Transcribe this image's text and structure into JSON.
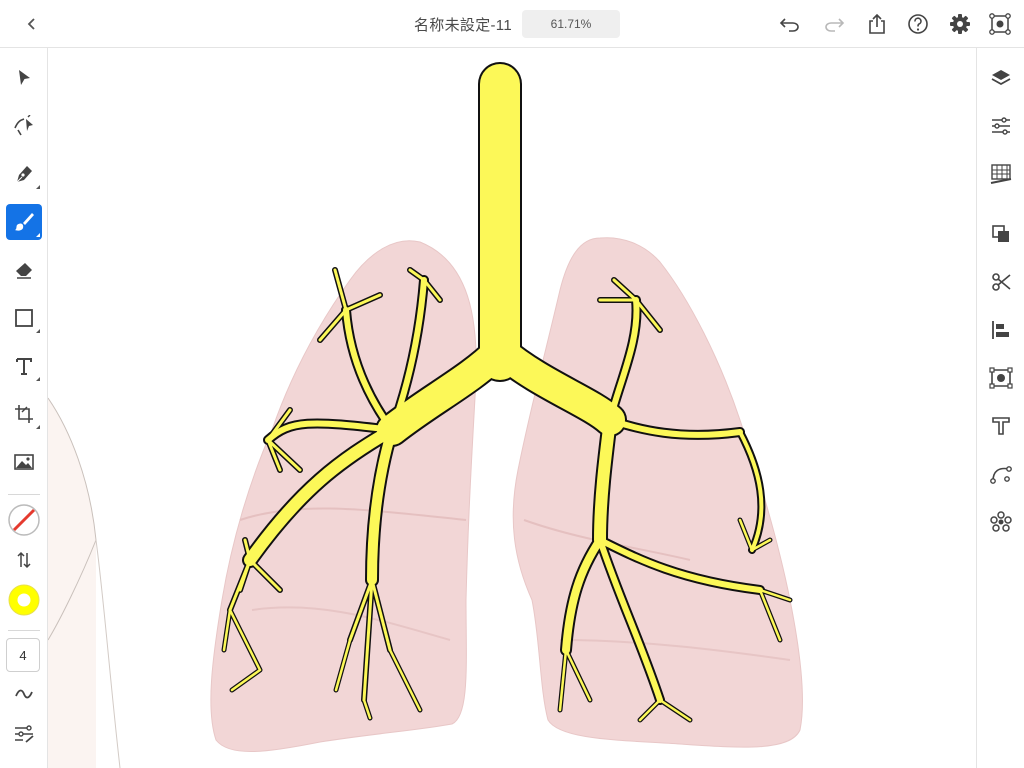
{
  "header": {
    "back_icon": "chevron-left-icon",
    "document_title": "名称未設定-11",
    "zoom_level": "61.71%",
    "actions": [
      {
        "name": "undo-icon"
      },
      {
        "name": "redo-icon"
      },
      {
        "name": "share-icon"
      },
      {
        "name": "help-icon"
      },
      {
        "name": "settings-icon"
      },
      {
        "name": "touch-shortcut-icon"
      }
    ]
  },
  "left_toolbar": {
    "tools": [
      {
        "name": "selection-tool-icon"
      },
      {
        "name": "shaper-tool-icon"
      },
      {
        "name": "pen-tool-icon"
      },
      {
        "name": "brush-tool-icon",
        "active": true
      },
      {
        "name": "eraser-tool-icon"
      },
      {
        "name": "shape-tool-icon"
      },
      {
        "name": "type-tool-icon"
      },
      {
        "name": "transform-tool-icon"
      },
      {
        "name": "image-place-icon"
      }
    ],
    "stroke_color_state": "none",
    "fill_color": "#ffff00",
    "stroke_size": "4",
    "smoothing_icon": "tilde-icon",
    "brush_settings_icon": "brush-settings-icon"
  },
  "right_toolbar": {
    "tools": [
      {
        "name": "layers-icon"
      },
      {
        "name": "properties-icon"
      },
      {
        "name": "grid-icon"
      },
      {
        "name": "arrange-icon"
      },
      {
        "name": "pathfinder-icon"
      },
      {
        "name": "align-icon"
      },
      {
        "name": "image-trace-icon"
      },
      {
        "name": "type-settings-icon"
      },
      {
        "name": "path-edit-icon"
      },
      {
        "name": "repeat-icon"
      }
    ]
  },
  "colors": {
    "accent": "#1473e6",
    "bronchi_fill": "#fcf858",
    "lung_fill": "#f2d6d6"
  }
}
